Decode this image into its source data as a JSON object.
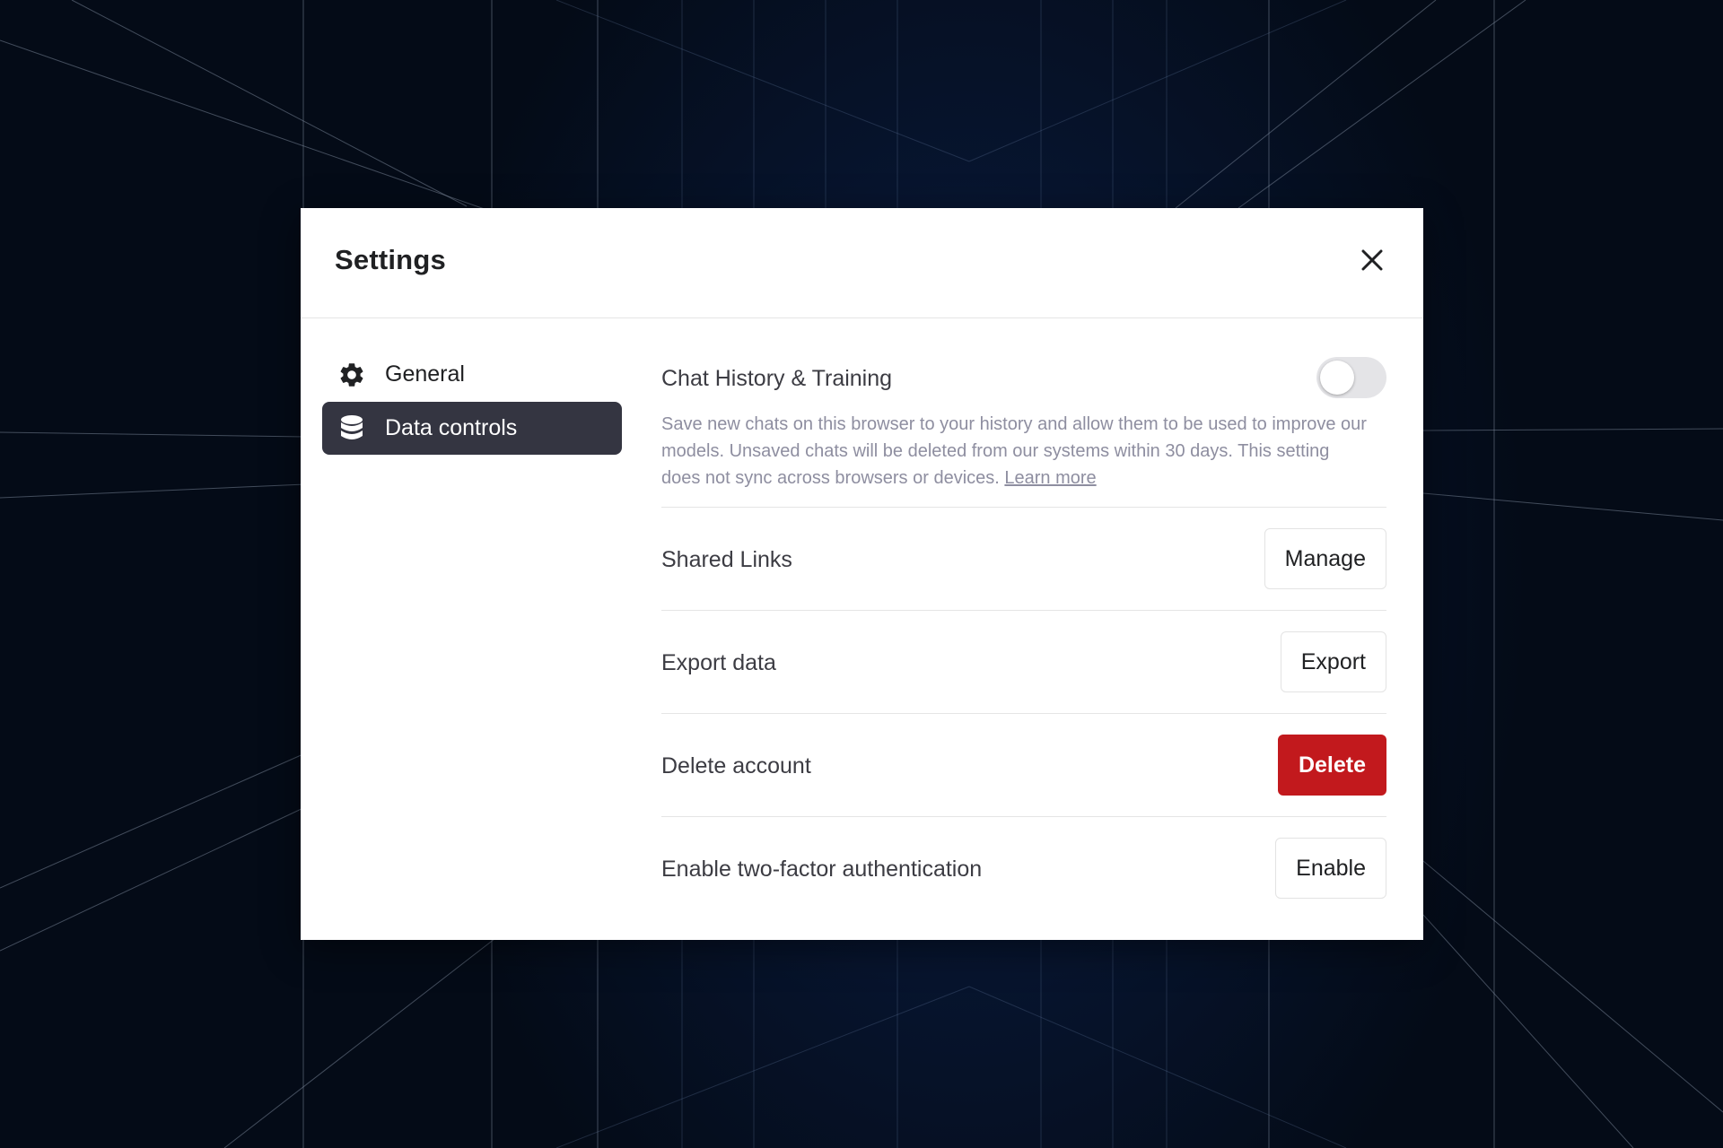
{
  "modal": {
    "title": "Settings",
    "close_icon": "close-icon"
  },
  "sidebar": {
    "items": [
      {
        "label": "General",
        "icon": "gear-icon",
        "active": false
      },
      {
        "label": "Data controls",
        "icon": "database-icon",
        "active": true
      }
    ]
  },
  "content": {
    "chat_history": {
      "label": "Chat History & Training",
      "enabled": false,
      "description": "Save new chats on this browser to your history and allow them to be used to improve our models. Unsaved chats will be deleted from our systems within 30 days. This setting does not sync across browsers or devices.",
      "learn_more": "Learn more"
    },
    "rows": [
      {
        "label": "Shared Links",
        "button": "Manage",
        "danger": false
      },
      {
        "label": "Export data",
        "button": "Export",
        "danger": false
      },
      {
        "label": "Delete account",
        "button": "Delete",
        "danger": true
      },
      {
        "label": "Enable two-factor authentication",
        "button": "Enable",
        "danger": false
      }
    ]
  },
  "colors": {
    "active_nav_bg": "#343541",
    "danger": "#c2191d",
    "toggle_off": "#e4e4e7"
  }
}
